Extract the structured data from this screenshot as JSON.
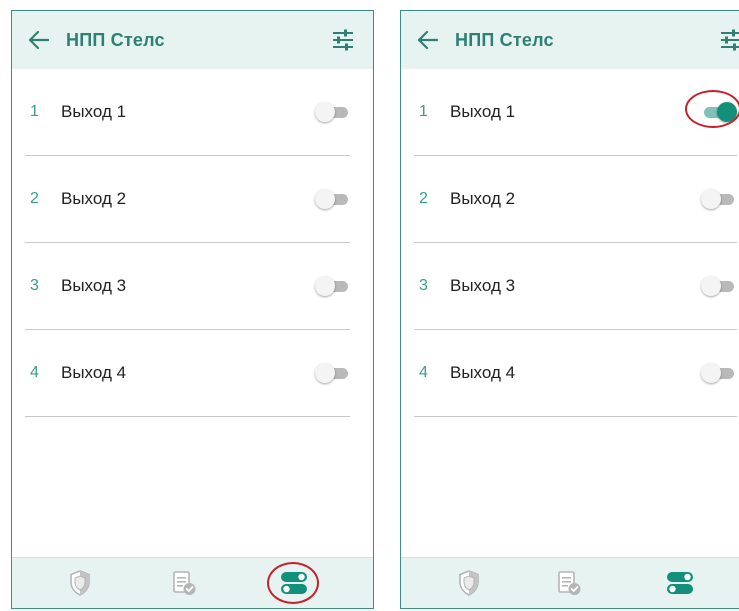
{
  "colors": {
    "accent": "#13907c",
    "header_bg": "#e6f3f0",
    "title": "#2e7f74",
    "annotation": "#c8202b"
  },
  "screens": [
    {
      "id": "left",
      "header": {
        "title": "НПП Стелс",
        "back_icon": "arrow-left-icon",
        "settings_icon": "sliders-icon"
      },
      "outputs": [
        {
          "number": "1",
          "label": "Выход 1",
          "on": false
        },
        {
          "number": "2",
          "label": "Выход 2",
          "on": false
        },
        {
          "number": "3",
          "label": "Выход 3",
          "on": false
        },
        {
          "number": "4",
          "label": "Выход 4",
          "on": false
        }
      ],
      "bottom_nav": [
        "shield-icon",
        "journal-check-icon",
        "toggles-icon"
      ],
      "active_nav": "toggles-icon",
      "annotation": "nav-outputs-circled"
    },
    {
      "id": "right",
      "header": {
        "title": "НПП Стелс",
        "back_icon": "arrow-left-icon",
        "settings_icon": "sliders-icon"
      },
      "outputs": [
        {
          "number": "1",
          "label": "Выход 1",
          "on": true
        },
        {
          "number": "2",
          "label": "Выход 2",
          "on": false
        },
        {
          "number": "3",
          "label": "Выход 3",
          "on": false
        },
        {
          "number": "4",
          "label": "Выход 4",
          "on": false
        }
      ],
      "bottom_nav": [
        "shield-icon",
        "journal-check-icon",
        "toggles-icon"
      ],
      "active_nav": "toggles-icon",
      "annotation": "output-1-switch-circled"
    }
  ]
}
